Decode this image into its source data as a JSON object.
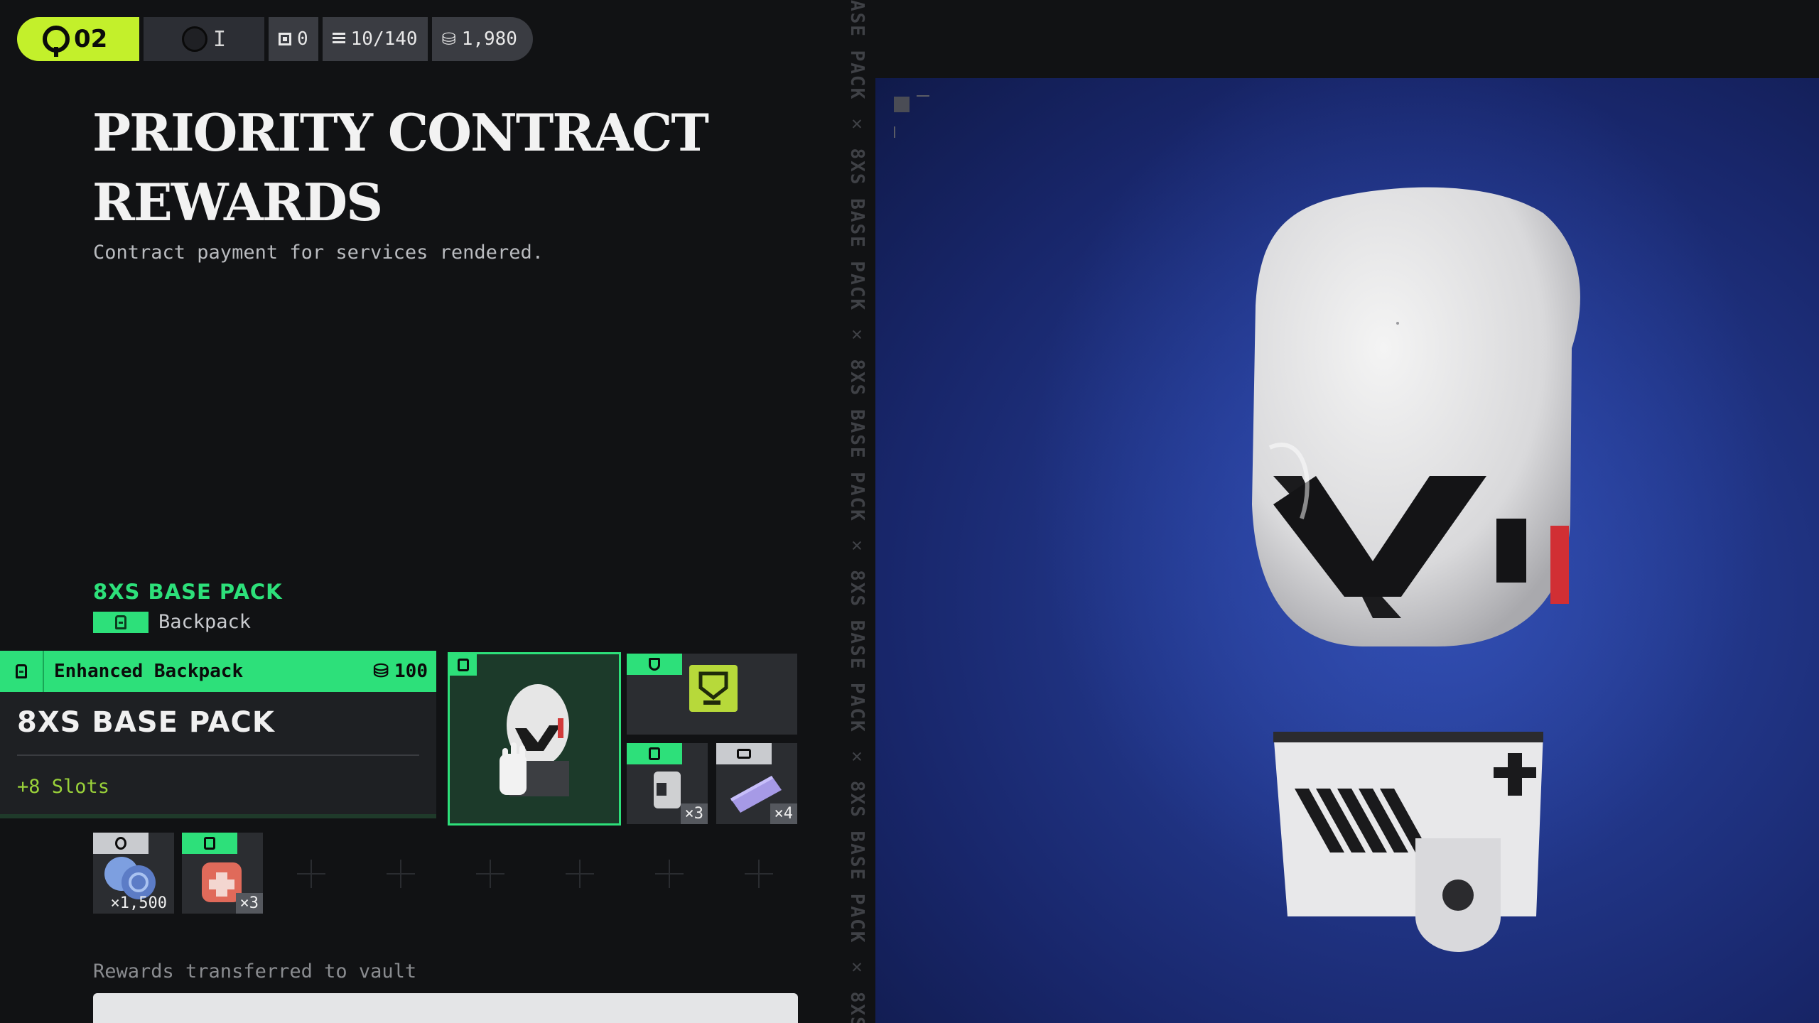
{
  "hud": {
    "rank": "02",
    "tier": "I",
    "keys": "0",
    "contracts": "10/140",
    "credits": "1,980"
  },
  "header": {
    "title": "PRIORITY CONTRACT REWARDS",
    "subtitle": "Contract payment for services rendered."
  },
  "item": {
    "name": "8XS BASE PACK",
    "type": "Backpack"
  },
  "card": {
    "category": "Enhanced Backpack",
    "cost": "100",
    "title": "8XS BASE PACK",
    "stat": "+8 Slots"
  },
  "rewards": [
    {
      "icon": "backpack-icon",
      "qty": ""
    },
    {
      "icon": "shield-icon",
      "qty": ""
    },
    {
      "icon": "grenade-icon",
      "qty": "×3"
    },
    {
      "icon": "ammo-icon",
      "qty": "×4"
    },
    {
      "icon": "player-icon",
      "qty": "×1,500"
    },
    {
      "icon": "grenade-icon",
      "qty": "×3"
    }
  ],
  "vault": {
    "status": "Rewards transferred to vault"
  },
  "strip": {
    "text": "ASE PACK ✕ 8XS BASE PACK ✕ 8XS BASE PACK ✕ 8XS BASE PACK ✕ 8XS BASE PACK ✕ 8XS"
  },
  "colors": {
    "accent_green": "#2de07a",
    "rank_lime": "#c3f02b",
    "background": "#111214",
    "viewport_blue": "#22378a"
  }
}
